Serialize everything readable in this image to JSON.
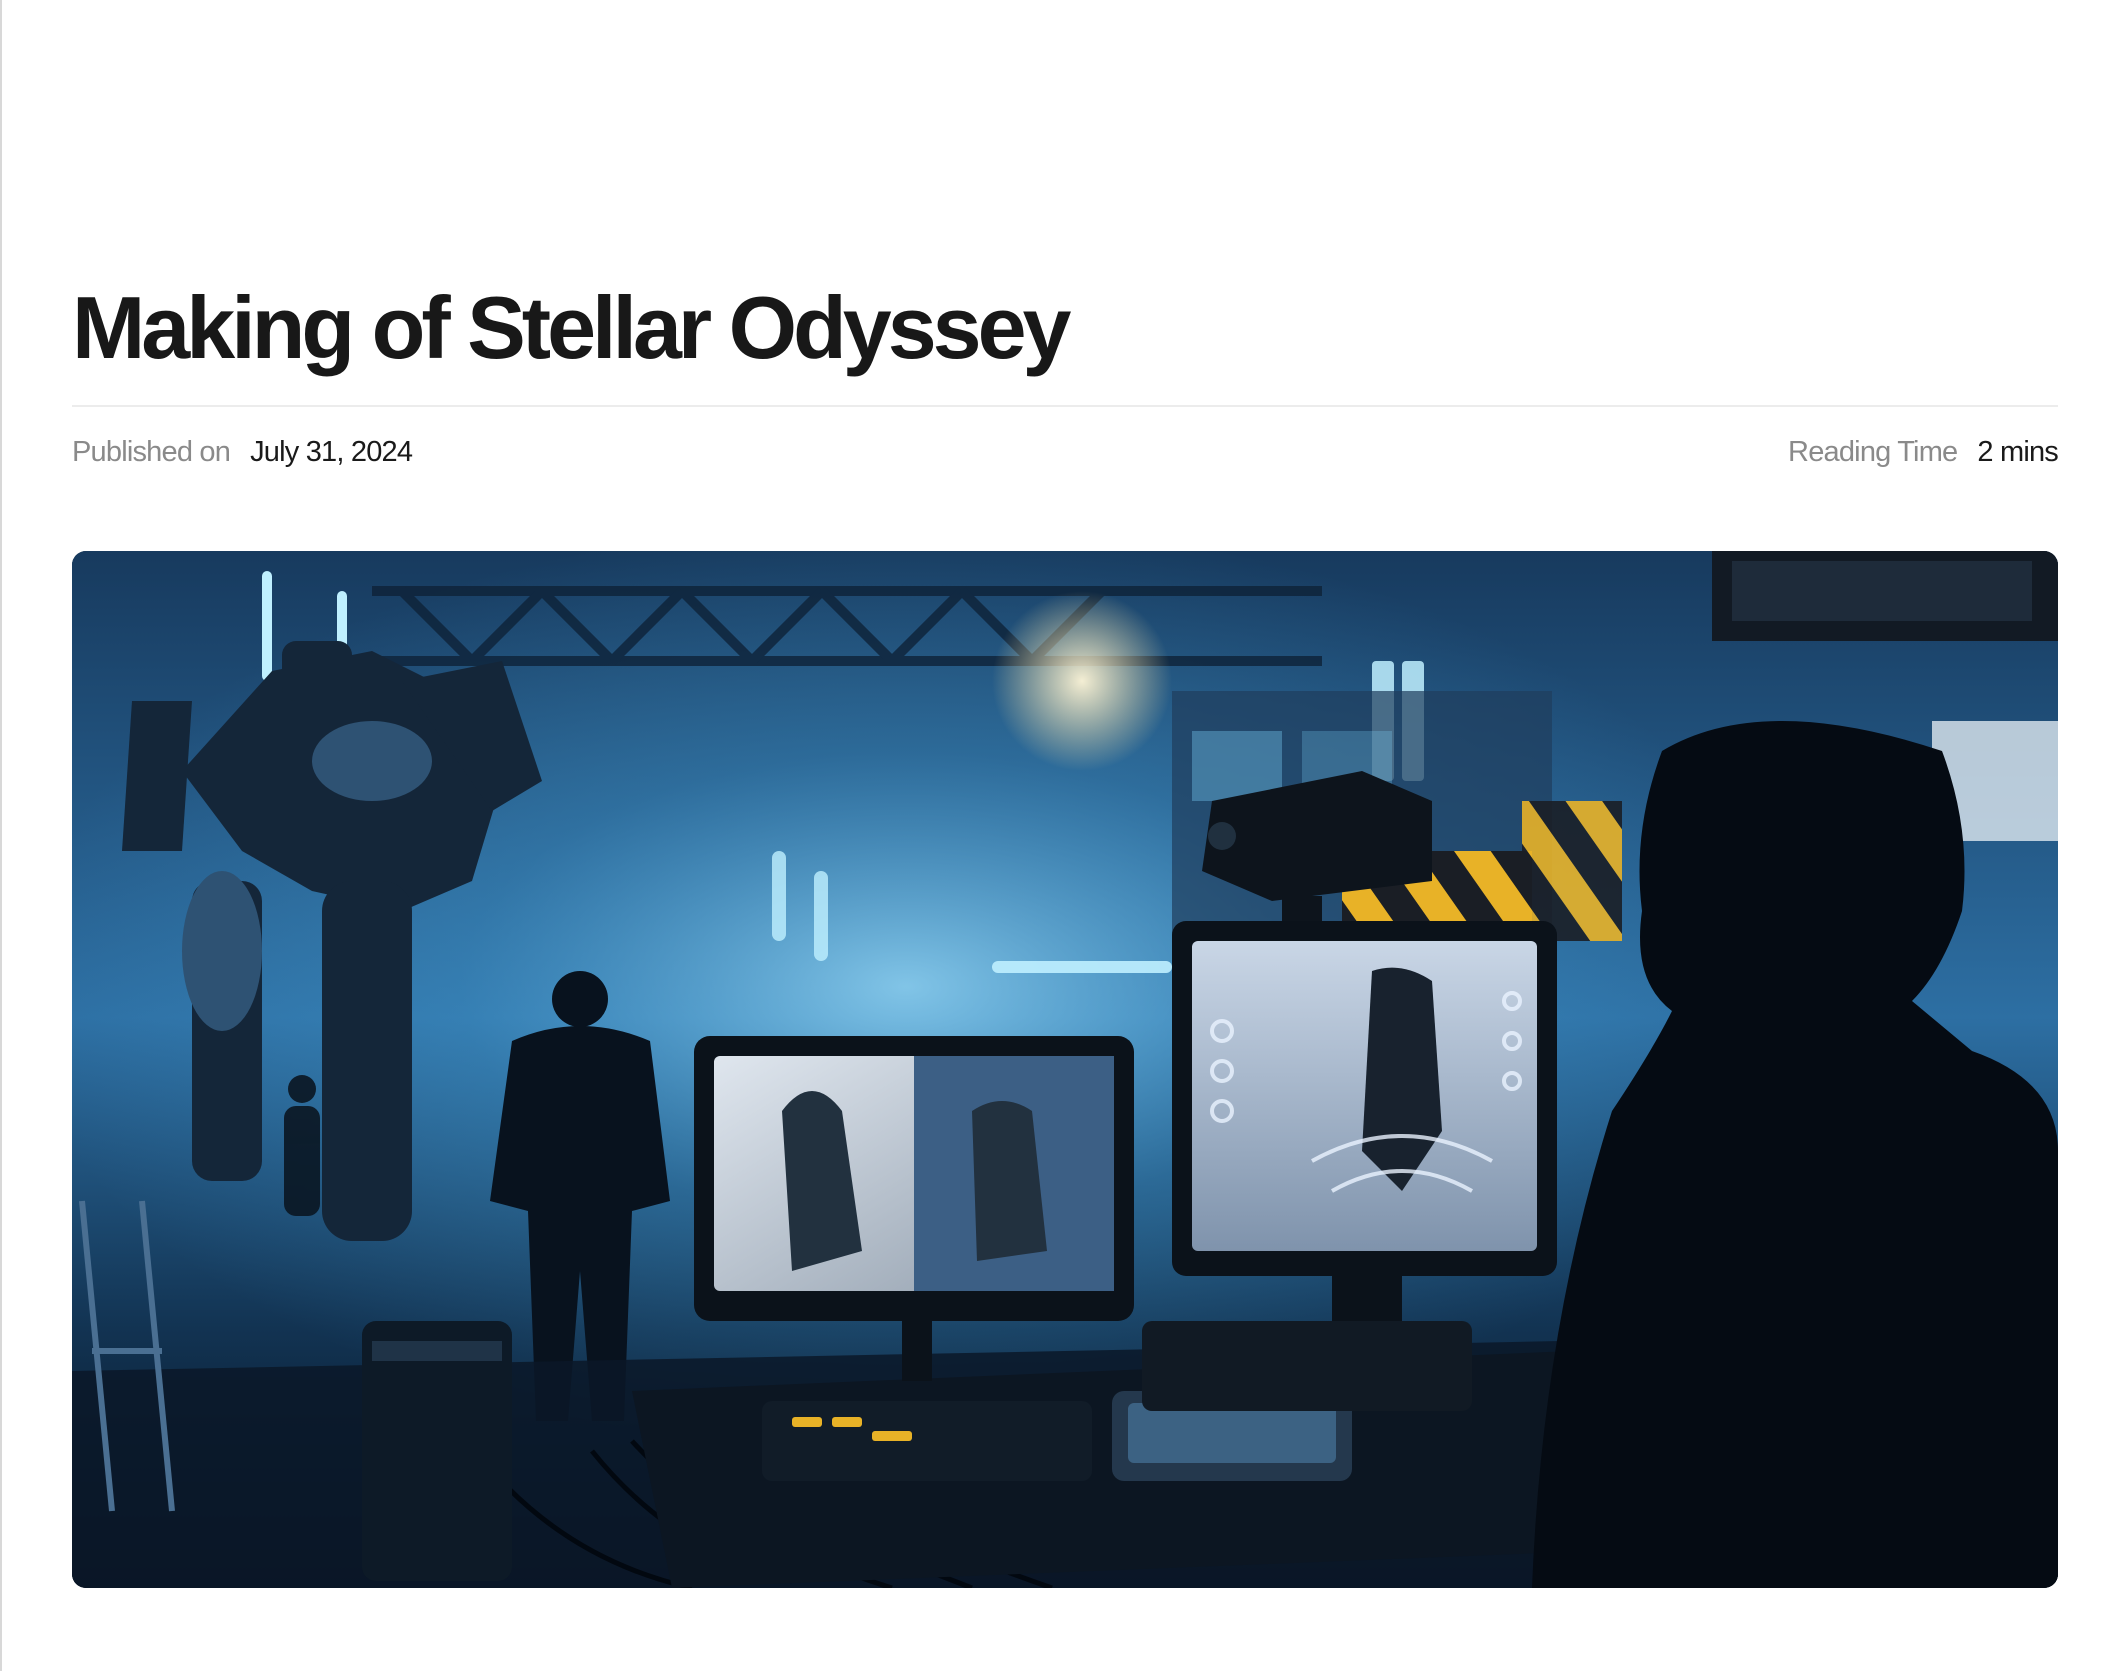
{
  "article": {
    "title": "Making of Stellar Odyssey",
    "published_label": "Published on",
    "published_date": "July 31, 2024",
    "reading_label": "Reading Time",
    "reading_value": "2 mins"
  },
  "hero": {
    "alt": "Film set of a sci-fi production with robots, monitors and a crew member watching screens",
    "palette": {
      "deep": "#071322",
      "mid": "#1d5a8c",
      "glow": "#7fd6ff",
      "warning": "#e8b227"
    }
  }
}
